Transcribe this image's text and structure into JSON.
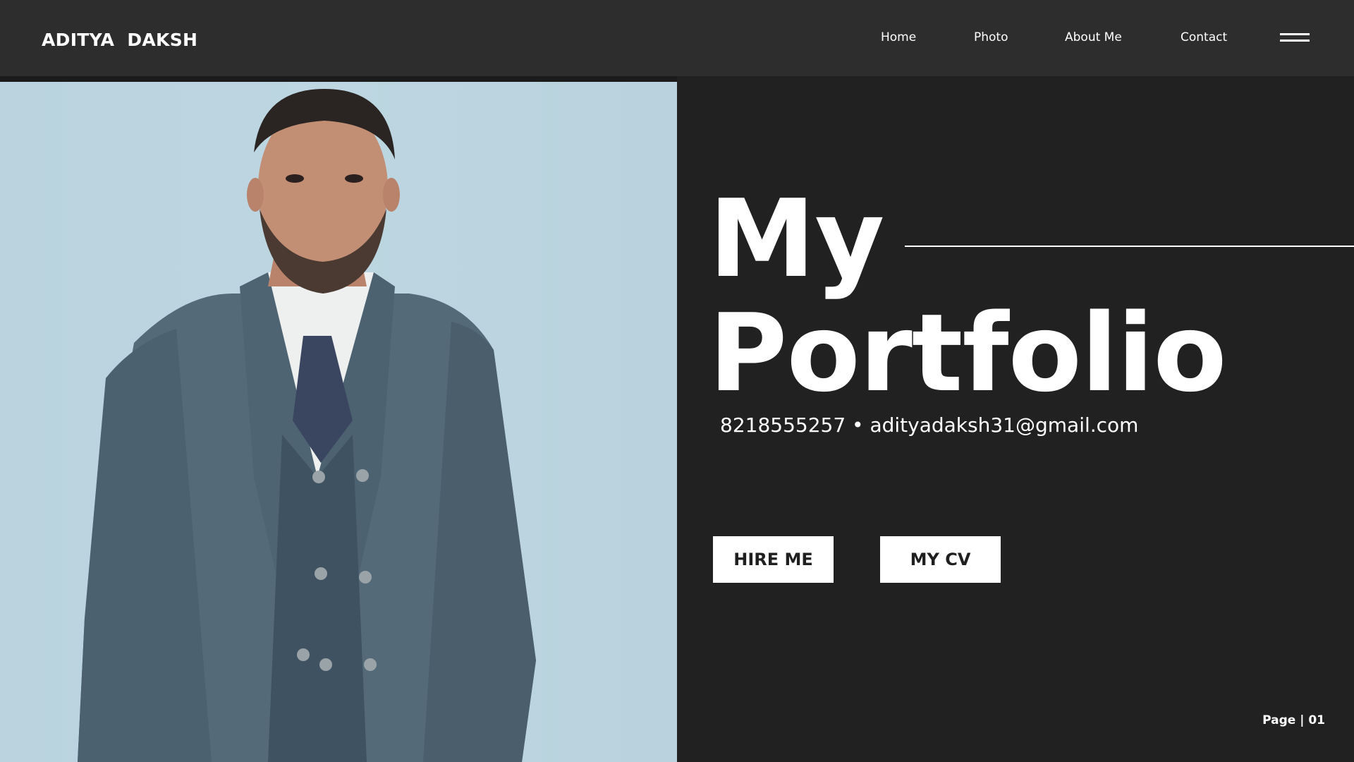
{
  "header": {
    "brand": "ADITYA  DAKSH",
    "nav": [
      {
        "label": "Home"
      },
      {
        "label": "Photo"
      },
      {
        "label": "About Me"
      },
      {
        "label": "Contact"
      }
    ],
    "menu_icon": "hamburger-menu-icon"
  },
  "hero": {
    "title_line1": "My",
    "title_line2": "Portfolio",
    "contact": "8218555257 • adityadaksh31@gmail.com",
    "buttons": {
      "hire": "HIRE ME",
      "cv": "MY CV"
    },
    "page": "Page | 01"
  },
  "colors": {
    "topbar": "#2d2d2d",
    "background": "#202120",
    "photo_bg": "#bad3df",
    "text": "#ffffff",
    "button_bg": "#ffffff",
    "button_text": "#1f1f1f"
  }
}
